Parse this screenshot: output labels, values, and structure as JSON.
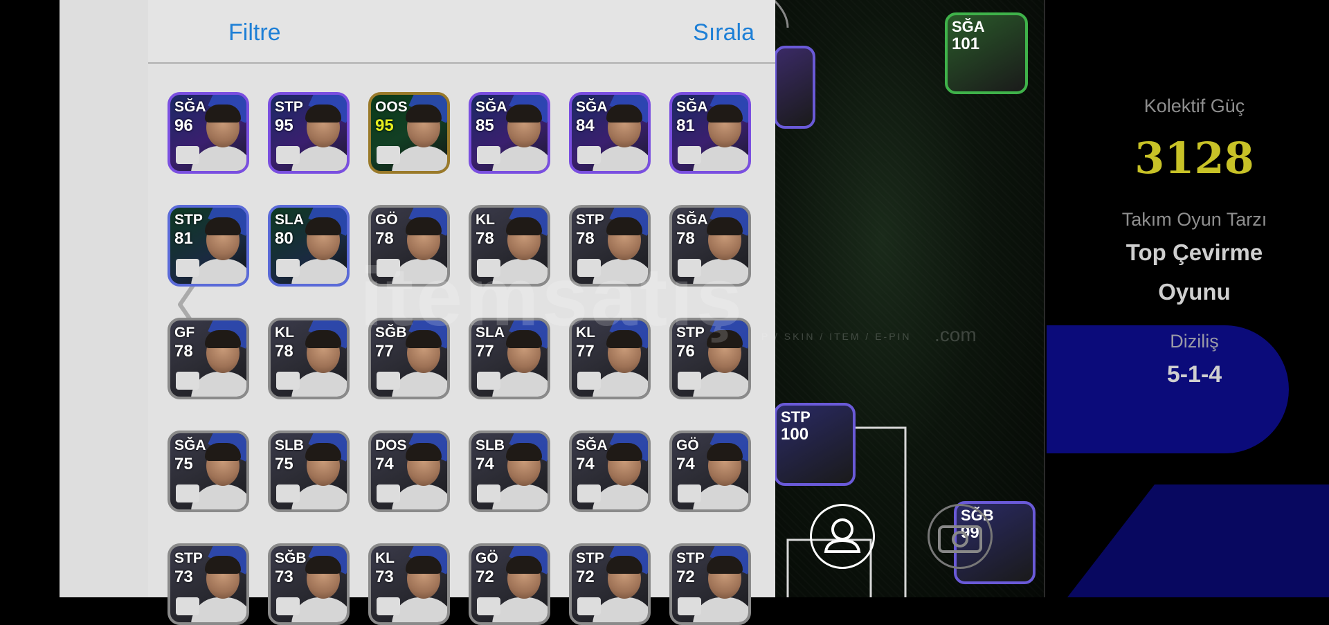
{
  "header": {
    "filter_label": "Filtre",
    "sort_label": "Sırala"
  },
  "players": [
    {
      "pos": "SĞA",
      "ovr": "96",
      "theme": "purple"
    },
    {
      "pos": "STP",
      "ovr": "95",
      "theme": "purple"
    },
    {
      "pos": "OOS",
      "ovr": "95",
      "theme": "gold",
      "yellow": true
    },
    {
      "pos": "SĞA",
      "ovr": "85",
      "theme": "purple"
    },
    {
      "pos": "SĞA",
      "ovr": "84",
      "theme": "purple"
    },
    {
      "pos": "SĞA",
      "ovr": "81",
      "theme": "purple"
    },
    {
      "pos": "STP",
      "ovr": "81",
      "theme": "green"
    },
    {
      "pos": "SLA",
      "ovr": "80",
      "theme": "green"
    },
    {
      "pos": "GÖ",
      "ovr": "78",
      "theme": "gray"
    },
    {
      "pos": "KL",
      "ovr": "78",
      "theme": "gray"
    },
    {
      "pos": "STP",
      "ovr": "78",
      "theme": "gray"
    },
    {
      "pos": "SĞA",
      "ovr": "78",
      "theme": "gray"
    },
    {
      "pos": "GF",
      "ovr": "78",
      "theme": "gray"
    },
    {
      "pos": "KL",
      "ovr": "78",
      "theme": "gray"
    },
    {
      "pos": "SĞB",
      "ovr": "77",
      "theme": "gray"
    },
    {
      "pos": "SLA",
      "ovr": "77",
      "theme": "gray"
    },
    {
      "pos": "KL",
      "ovr": "77",
      "theme": "gray"
    },
    {
      "pos": "STP",
      "ovr": "76",
      "theme": "gray"
    },
    {
      "pos": "SĞA",
      "ovr": "75",
      "theme": "gray"
    },
    {
      "pos": "SLB",
      "ovr": "75",
      "theme": "gray"
    },
    {
      "pos": "DOS",
      "ovr": "74",
      "theme": "gray"
    },
    {
      "pos": "SLB",
      "ovr": "74",
      "theme": "gray"
    },
    {
      "pos": "SĞA",
      "ovr": "74",
      "theme": "gray"
    },
    {
      "pos": "GÖ",
      "ovr": "74",
      "theme": "gray"
    },
    {
      "pos": "STP",
      "ovr": "73",
      "theme": "gray"
    },
    {
      "pos": "SĞB",
      "ovr": "73",
      "theme": "gray"
    },
    {
      "pos": "KL",
      "ovr": "73",
      "theme": "gray"
    },
    {
      "pos": "GÖ",
      "ovr": "72",
      "theme": "gray"
    },
    {
      "pos": "STP",
      "ovr": "72",
      "theme": "gray"
    },
    {
      "pos": "STP",
      "ovr": "72",
      "theme": "gray"
    }
  ],
  "field_cards": [
    {
      "pos": "SĞA",
      "ovr": "101"
    },
    {
      "pos": "STP",
      "ovr": "100"
    },
    {
      "pos": "SĞB",
      "ovr": "99"
    }
  ],
  "team_panel": {
    "power_label": "Kolektif Güç",
    "power_value": "3128",
    "style_label": "Takım Oyun Tarzı",
    "style_value_line1": "Top Çevirme",
    "style_value_line2": "Oyunu",
    "formation_label": "Diziliş",
    "formation_value": "5-1-4"
  },
  "watermark": {
    "text": "itemsatış",
    "sub": "P / SKIN / ITEM / E-PIN",
    "com": ".com"
  },
  "colors": {
    "accent": "#1d7fd6",
    "power": "#c8c227",
    "panel_bg": "#e2e2e2",
    "formation_bg": "#0b0b7a"
  }
}
